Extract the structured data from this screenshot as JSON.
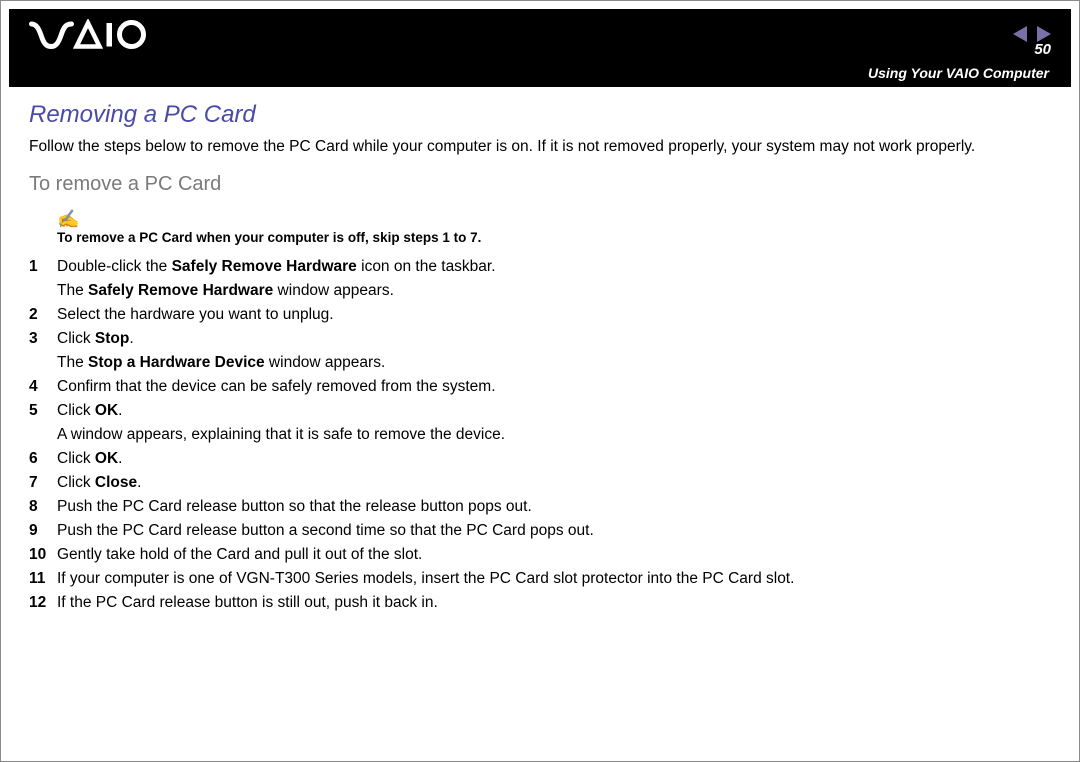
{
  "header": {
    "logo_alt": "VAIO",
    "page_number": "50",
    "breadcrumb": "Using Your VAIO Computer"
  },
  "content": {
    "main_heading": "Removing a PC Card",
    "intro": "Follow the steps below to remove the PC Card while your computer is on. If it is not removed properly, your system may not work properly.",
    "sub_heading": "To remove a PC Card",
    "note_icon": "✍",
    "note_text": "To remove a PC Card when your computer is off, skip steps 1 to 7.",
    "steps": {
      "s1_num": "1",
      "s1_a": "Double-click the ",
      "s1_b": "Safely Remove Hardware",
      "s1_c": " icon on the taskbar.",
      "s1_d": "The ",
      "s1_e": "Safely Remove Hardware",
      "s1_f": " window appears.",
      "s2_num": "2",
      "s2": "Select the hardware you want to unplug.",
      "s3_num": "3",
      "s3_a": "Click ",
      "s3_b": "Stop",
      "s3_c": ".",
      "s3_d": "The ",
      "s3_e": "Stop a Hardware Device",
      "s3_f": " window appears.",
      "s4_num": "4",
      "s4": "Confirm that the device can be safely removed from the system.",
      "s5_num": "5",
      "s5_a": "Click ",
      "s5_b": "OK",
      "s5_c": ".",
      "s5_d": "A window appears, explaining that it is safe to remove the device.",
      "s6_num": "6",
      "s6_a": "Click ",
      "s6_b": "OK",
      "s6_c": ".",
      "s7_num": "7",
      "s7_a": "Click ",
      "s7_b": "Close",
      "s7_c": ".",
      "s8_num": "8",
      "s8": "Push the PC Card release button so that the release button pops out.",
      "s9_num": "9",
      "s9": "Push the PC Card release button a second time so that the PC Card pops out.",
      "s10_num": "10",
      "s10": "Gently take hold of the Card and pull it out of the slot.",
      "s11_num": "11",
      "s11": "If your computer is one of VGN-T300 Series models, insert the PC Card slot protector into the PC Card slot.",
      "s12_num": "12",
      "s12": "If the PC Card release button is still out, push it back in."
    }
  }
}
